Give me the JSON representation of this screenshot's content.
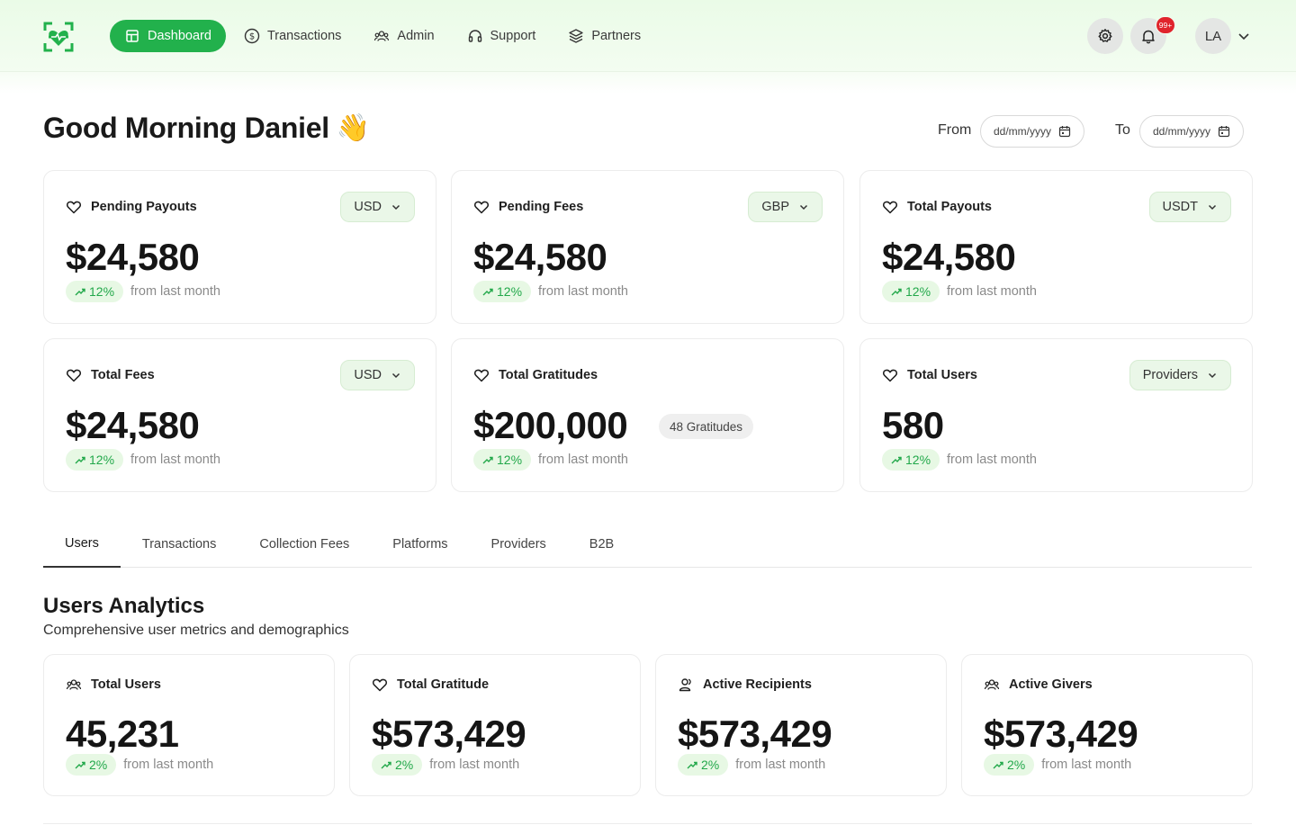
{
  "nav": {
    "items": [
      {
        "label": "Dashboard",
        "icon": "dashboard-icon",
        "active": true
      },
      {
        "label": "Transactions",
        "icon": "dollar-circle-icon",
        "active": false
      },
      {
        "label": "Admin",
        "icon": "users-group-icon",
        "active": false
      },
      {
        "label": "Support",
        "icon": "headphones-icon",
        "active": false
      },
      {
        "label": "Partners",
        "icon": "layers-icon",
        "active": false
      }
    ],
    "notification_count": "99+",
    "avatar_initials": "LA"
  },
  "header": {
    "greeting": "Good Morning Daniel",
    "emoji": "👋",
    "from_label": "From",
    "to_label": "To",
    "from_placeholder": "dd/mm/yyyy",
    "to_placeholder": "dd/mm/yyyy"
  },
  "stats": [
    {
      "title": "Pending Payouts",
      "currency": "USD",
      "value": "$24,580",
      "trend": "12%",
      "trend_text": "from last month"
    },
    {
      "title": "Pending Fees",
      "currency": "GBP",
      "value": "$24,580",
      "trend": "12%",
      "trend_text": "from last month"
    },
    {
      "title": "Total Payouts",
      "currency": "USDT",
      "value": "$24,580",
      "trend": "12%",
      "trend_text": "from last month"
    },
    {
      "title": "Total Fees",
      "currency": "USD",
      "value": "$24,580",
      "trend": "12%",
      "trend_text": "from last month"
    },
    {
      "title": "Total Gratitudes",
      "value": "$200,000",
      "extra": "48 Gratitudes",
      "trend": "12%",
      "trend_text": "from last month"
    },
    {
      "title": "Total Users",
      "currency": "Providers",
      "value": "580",
      "trend": "12%",
      "trend_text": "from last month"
    }
  ],
  "tabs": [
    {
      "label": "Users",
      "active": true
    },
    {
      "label": "Transactions",
      "active": false
    },
    {
      "label": "Collection Fees",
      "active": false
    },
    {
      "label": "Platforms",
      "active": false
    },
    {
      "label": "Providers",
      "active": false
    },
    {
      "label": "B2B",
      "active": false
    }
  ],
  "analytics": {
    "title": "Users Analytics",
    "subtitle": "Comprehensive user metrics and demographics",
    "cards": [
      {
        "title": "Total Users",
        "icon": "users-group-icon",
        "value": "45,231",
        "trend": "2%",
        "trend_text": "from last month"
      },
      {
        "title": "Total Gratitude",
        "icon": "heart-icon",
        "value": "$573,429",
        "trend": "2%",
        "trend_text": "from last month"
      },
      {
        "title": "Active Recipients",
        "icon": "users-icon",
        "value": "$573,429",
        "trend": "2%",
        "trend_text": "from last month"
      },
      {
        "title": "Active Givers",
        "icon": "users-group-icon",
        "value": "$573,429",
        "trend": "2%",
        "trend_text": "from last month"
      }
    ]
  },
  "colors": {
    "accent": "#22b14c",
    "trend_green": "#22a84a",
    "badge_red": "#e0242c"
  }
}
